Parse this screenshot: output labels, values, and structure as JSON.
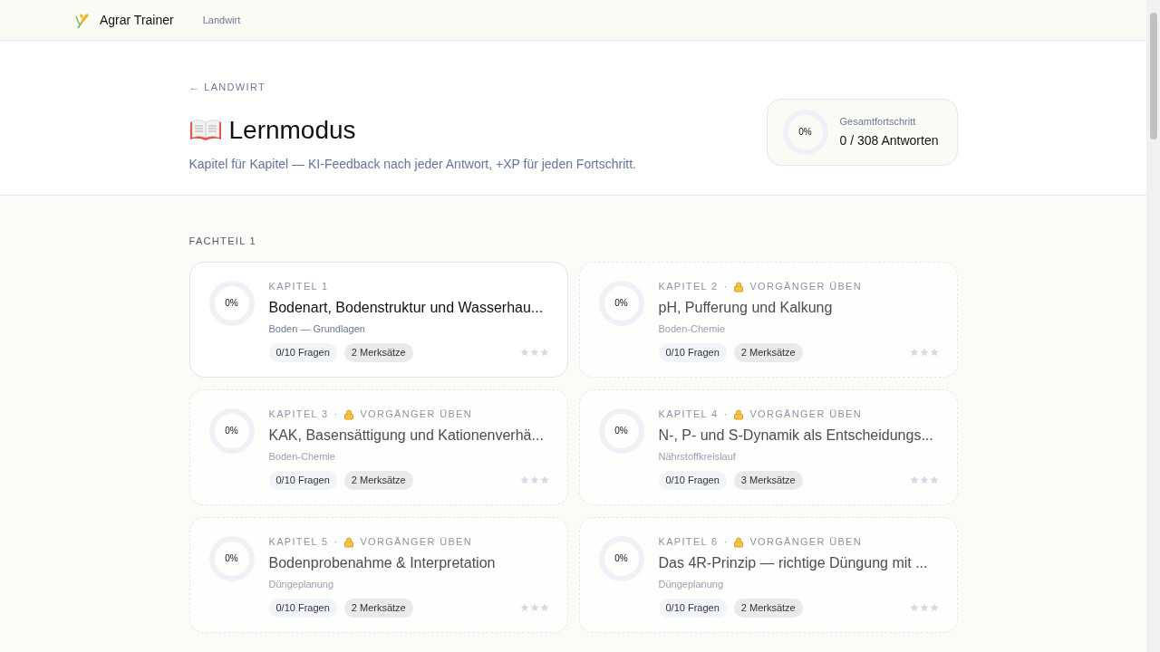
{
  "nav": {
    "brand": "Agrar Trainer",
    "links": [
      "Landwirt"
    ]
  },
  "hero": {
    "back": "← LANDWIRT",
    "title": "Lernmodus",
    "subtitle": "Kapitel für Kapitel — KI-Feedback nach jeder Antwort, +XP für jeden Fortschritt."
  },
  "overall": {
    "level": 0,
    "percent": "0%",
    "label": "Gesamtfortschritt",
    "value": "0 / 308 Antworten"
  },
  "section": {
    "title": "FACHTEIL 1"
  },
  "chapters": [
    {
      "number": "KAPITEL 1",
      "locked": false,
      "title": "Bodenart, Bodenstruktur und Wasserhau...",
      "topic": "Boden — Grundlagen",
      "questions": "0/10 Fragen",
      "facts": "2 Merksätze",
      "level": 0,
      "percent": "0%",
      "stars": 0
    },
    {
      "number": "KAPITEL 2",
      "locked": true,
      "separator": "·",
      "lock_note": "VORGÄNGER ÜBEN",
      "title": "pH, Pufferung und Kalkung",
      "topic": "Boden-Chemie",
      "questions": "0/10 Fragen",
      "facts": "2 Merksätze",
      "level": 0,
      "percent": "0%",
      "stars": 0
    },
    {
      "number": "KAPITEL 3",
      "locked": true,
      "separator": "·",
      "lock_note": "VORGÄNGER ÜBEN",
      "title": "KAK, Basensättigung und Kationenverhä...",
      "topic": "Boden-Chemie",
      "questions": "0/10 Fragen",
      "facts": "2 Merksätze",
      "level": 0,
      "percent": "0%",
      "stars": 0
    },
    {
      "number": "KAPITEL 4",
      "locked": true,
      "separator": "·",
      "lock_note": "VORGÄNGER ÜBEN",
      "title": "N-, P- und S-Dynamik als Entscheidungs...",
      "topic": "Nährstoffkreislauf",
      "questions": "0/10 Fragen",
      "facts": "3 Merksätze",
      "level": 0,
      "percent": "0%",
      "stars": 0
    },
    {
      "number": "KAPITEL 5",
      "locked": true,
      "separator": "·",
      "lock_note": "VORGÄNGER ÜBEN",
      "title": "Bodenprobenahme & Interpretation",
      "topic": "Düngeplanung",
      "questions": "0/10 Fragen",
      "facts": "2 Merksätze",
      "level": 0,
      "percent": "0%",
      "stars": 0
    },
    {
      "number": "KAPITEL 6",
      "locked": true,
      "separator": "·",
      "lock_note": "VORGÄNGER ÜBEN",
      "title": "Das 4R-Prinzip — richtige Düngung mit ...",
      "topic": "Düngeplanung",
      "questions": "0/10 Fragen",
      "facts": "2 Merksätze",
      "level": 0,
      "percent": "0%",
      "stars": 0
    }
  ]
}
